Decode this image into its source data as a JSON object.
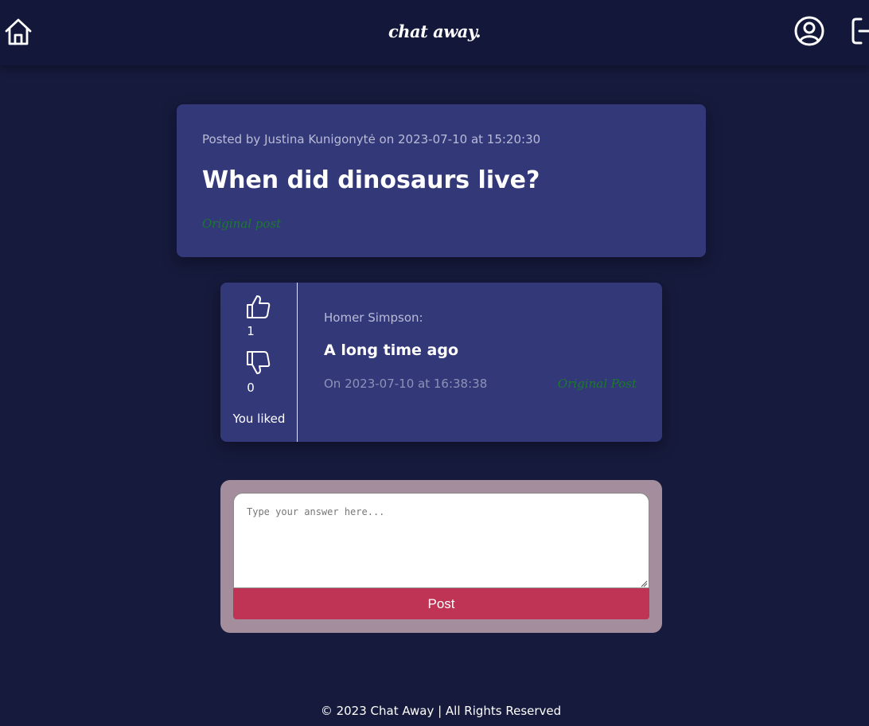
{
  "header": {
    "brand": "chat away.",
    "icons": [
      "home-icon",
      "user-circle-icon",
      "logout-icon"
    ]
  },
  "post": {
    "meta": "Posted by Justina Kunigonytė on 2023-07-10 at 15:20:30",
    "title": "When did dinosaurs live?",
    "tag": "Original post"
  },
  "answer": {
    "likes": "1",
    "dislikes": "0",
    "status": "You liked",
    "author": "Homer Simpson:",
    "text": "A long time ago",
    "date": "On 2023-07-10 at 16:38:38",
    "tag": "Original Post"
  },
  "reply": {
    "placeholder": "Type your answer here...",
    "button": "Post"
  },
  "footer": {
    "text": "© 2023 Chat Away | All Rights Reserved"
  },
  "colors": {
    "page_bg": "#161a3c",
    "header_bg": "#13173a",
    "card_bg": "#333879",
    "accent_green": "#1a7a2a",
    "reply_bg": "#a48e9e",
    "post_button": "#bf3454"
  }
}
